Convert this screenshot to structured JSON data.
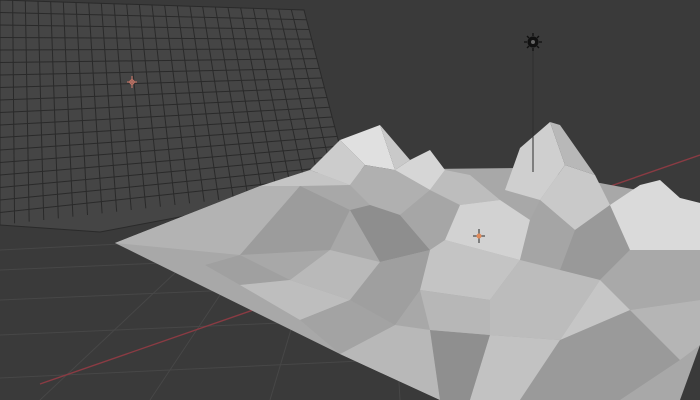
{
  "viewport": {
    "background": "#3a3a3a",
    "floor_grid_color": "#474747",
    "x_axis_color": "#8a3b43",
    "y_axis_color": "#6c7a3a"
  },
  "scene": {
    "grid_plane": {
      "face_color": "#454545",
      "wire_color": "#2a2a2a"
    },
    "terrain": {
      "base_color": "#a7a7a7",
      "light_color": "#d0d0d0",
      "shadow_color": "#8a8a8a"
    },
    "icons": [
      "object-origin-icon",
      "light-icon",
      "object-origin-icon"
    ]
  }
}
